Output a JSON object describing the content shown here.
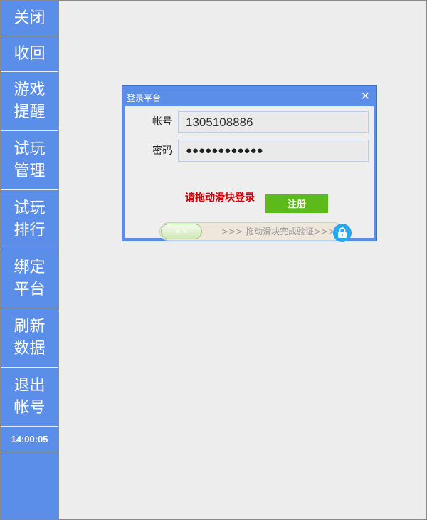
{
  "sidebar": {
    "items": [
      {
        "lines": [
          "关闭"
        ]
      },
      {
        "lines": [
          "收回"
        ]
      },
      {
        "lines": [
          "游戏",
          "提醒"
        ]
      },
      {
        "lines": [
          "试玩",
          "管理"
        ]
      },
      {
        "lines": [
          "试玩",
          "排行"
        ]
      },
      {
        "lines": [
          "绑定",
          "平台"
        ]
      },
      {
        "lines": [
          "刷新",
          "数据"
        ]
      },
      {
        "lines": [
          "退出",
          "帐号"
        ]
      }
    ],
    "time": "14:00:05"
  },
  "dialog": {
    "title": "登录平台",
    "close_glyph": "✕",
    "account_label": "帐号",
    "account_value": "1305108886",
    "password_label": "密码",
    "password_mask": "●●●●●●●●●●●●",
    "hint": "请拖动滑块登录",
    "register_label": "注册",
    "slider_handle_glyph": "« »",
    "slider_text": ">>> 拖动滑块完成验证>>>"
  },
  "colors": {
    "sidebar": "#5b8ee8",
    "dialog_frame": "#5b8ee8",
    "register_button": "#5cbb1a",
    "hint": "#cc0000",
    "lock": "#2aa6ef"
  },
  "icons": {
    "close": "close-icon",
    "lock": "lock-icon"
  }
}
